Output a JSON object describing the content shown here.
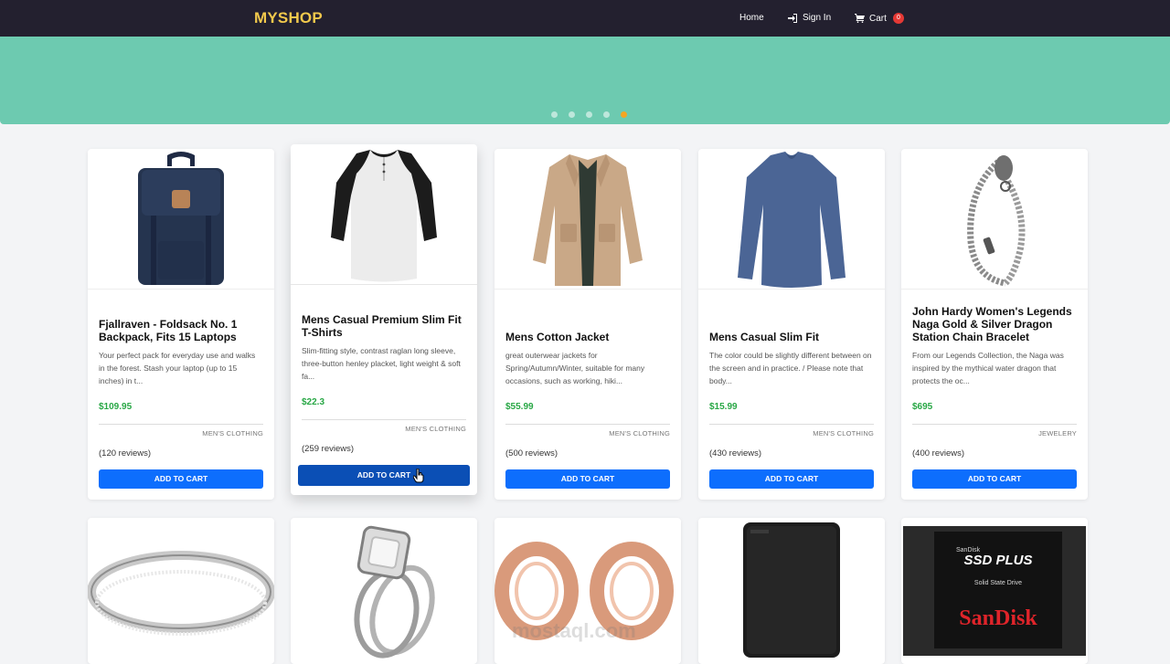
{
  "nav": {
    "brand": "MYSHOP",
    "home": "Home",
    "signin": "Sign In",
    "cart": "Cart",
    "cart_count": "0"
  },
  "hero": {
    "color": "#6dcab0",
    "dots": 5,
    "active_dot": 4
  },
  "products": [
    {
      "title": "Fjallraven - Foldsack No. 1 Backpack, Fits 15 Laptops",
      "description": "Your perfect pack for everyday use and walks in the forest. Stash your laptop (up to 15 inches) in t...",
      "price": "$109.95",
      "category": "MEN'S CLOTHING",
      "reviews": "(120 reviews)",
      "button": "ADD TO CART",
      "icon": "backpack-icon"
    },
    {
      "title": "Mens Casual Premium Slim Fit T-Shirts",
      "description": "Slim-fitting style, contrast raglan long sleeve, three-button henley placket, light weight & soft fa...",
      "price": "$22.3",
      "category": "MEN'S CLOTHING",
      "reviews": "(259 reviews)",
      "button": "ADD TO CART",
      "icon": "tshirt-icon"
    },
    {
      "title": "Mens Cotton Jacket",
      "description": "great outerwear jackets for Spring/Autumn/Winter, suitable for many occasions, such as working, hiki...",
      "price": "$55.99",
      "category": "MEN'S CLOTHING",
      "reviews": "(500 reviews)",
      "button": "ADD TO CART",
      "icon": "jacket-icon"
    },
    {
      "title": "Mens Casual Slim Fit",
      "description": "The color could be slightly different between on the screen and in practice. / Please note that body...",
      "price": "$15.99",
      "category": "MEN'S CLOTHING",
      "reviews": "(430 reviews)",
      "button": "ADD TO CART",
      "icon": "longsleeve-icon"
    },
    {
      "title": "John Hardy Women's Legends Naga Gold & Silver Dragon Station Chain Bracelet",
      "description": "From our Legends Collection, the Naga was inspired by the mythical water dragon that protects the oc...",
      "price": "$695",
      "category": "JEWELERY",
      "reviews": "(400 reviews)",
      "button": "ADD TO CART",
      "icon": "bracelet-icon"
    }
  ],
  "second_row": [
    {
      "icon": "ring-band-icon"
    },
    {
      "icon": "diamond-ring-icon"
    },
    {
      "icon": "rose-gold-rings-icon"
    },
    {
      "icon": "hard-drive-icon"
    },
    {
      "icon": "ssd-icon",
      "brand": "SanDisk",
      "label": "SSD PLUS",
      "sublabel": "Solid State Drive",
      "small_brand": "SanDisk"
    }
  ],
  "watermark": "mostaql.com",
  "colors": {
    "navbar": "#23202f",
    "brand": "#f2c94c",
    "price": "#28a745",
    "button": "#0d6efd",
    "badge": "#e53935"
  }
}
